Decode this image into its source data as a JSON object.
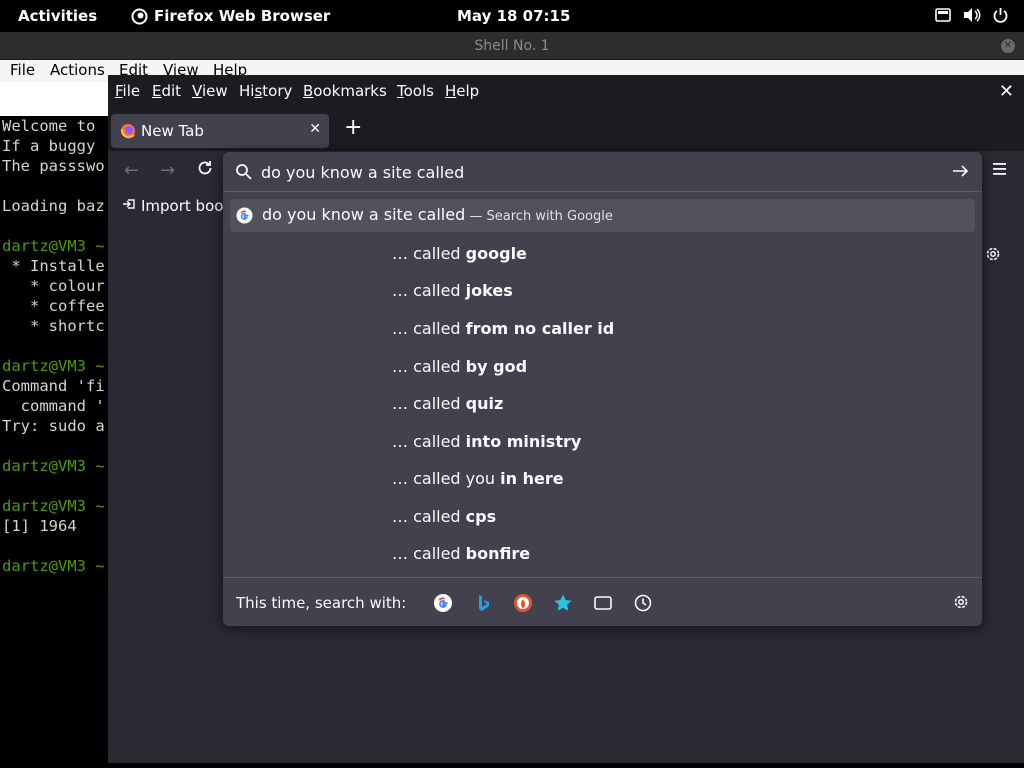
{
  "topbar": {
    "activities": "Activities",
    "app_name": "Firefox Web Browser",
    "clock": "May 18  07:15"
  },
  "terminal": {
    "title": "Shell No. 1",
    "menu": [
      "File",
      "Actions",
      "Edit",
      "View",
      "Help"
    ],
    "lines": [
      {
        "text": "Welcome to",
        "green": false
      },
      {
        "text": "If a buggy",
        "green": false
      },
      {
        "text": "The passswo",
        "green": false
      },
      {
        "text": "",
        "green": false
      },
      {
        "text": "Loading baz",
        "green": false
      },
      {
        "text": "",
        "green": false
      },
      {
        "text": "dartz@VM3 ~",
        "green": true
      },
      {
        "text": " * Installe",
        "green": false
      },
      {
        "text": "   * colour",
        "green": false
      },
      {
        "text": "   * coffee",
        "green": false
      },
      {
        "text": "   * shortc",
        "green": false
      },
      {
        "text": "",
        "green": false
      },
      {
        "text": "dartz@VM3 ~",
        "green": true
      },
      {
        "text": "Command 'fi",
        "green": false
      },
      {
        "text": "  command '",
        "green": false
      },
      {
        "text": "Try: sudo a",
        "green": false
      },
      {
        "text": "",
        "green": false
      },
      {
        "text": "dartz@VM3 ~",
        "green": true
      },
      {
        "text": "",
        "green": false
      },
      {
        "text": "dartz@VM3 ~",
        "green": true
      },
      {
        "text": "[1] 1964",
        "green": false
      },
      {
        "text": "",
        "green": false
      },
      {
        "text": "dartz@VM3 ~",
        "green": true
      }
    ]
  },
  "firefox": {
    "menu": {
      "file": {
        "u": "F",
        "rest": "ile"
      },
      "edit": {
        "u": "E",
        "rest": "dit"
      },
      "view": {
        "u": "V",
        "rest": "iew"
      },
      "history": {
        "pre": "Hi",
        "u": "s",
        "rest": "tory"
      },
      "bookmarks": {
        "u": "B",
        "rest": "ookmarks"
      },
      "tools": {
        "u": "T",
        "rest": "ools"
      },
      "help": {
        "u": "H",
        "rest": "elp"
      }
    },
    "tab_label": "New Tab",
    "import_bookmarks": "Import boo",
    "url_value": "do you know a site called",
    "heuristic": {
      "text": "do you know a site called",
      "action": " — Search with Google"
    },
    "suggestions": [
      {
        "prefix": "… called ",
        "plain": "",
        "bold": "google"
      },
      {
        "prefix": "… called ",
        "plain": "",
        "bold": "jokes"
      },
      {
        "prefix": "… called ",
        "plain": "",
        "bold": "from no caller id"
      },
      {
        "prefix": "… called ",
        "plain": "",
        "bold": "by god"
      },
      {
        "prefix": "… called ",
        "plain": "",
        "bold": "quiz"
      },
      {
        "prefix": "… called ",
        "plain": "",
        "bold": "into ministry"
      },
      {
        "prefix": "… called ",
        "plain": "you ",
        "bold": "in here"
      },
      {
        "prefix": "… called ",
        "plain": "",
        "bold": "cps"
      },
      {
        "prefix": "… called ",
        "plain": "",
        "bold": "bonfire"
      }
    ],
    "one_offs_label": "This time, search with:",
    "one_off_icons": [
      "google-icon",
      "bing-icon",
      "duckduckgo-icon",
      "bookmarks-star-icon",
      "tabs-icon",
      "history-icon"
    ]
  },
  "colors": {
    "terminal_prompt": "#4e9a06",
    "firefox_bg": "#2b2a33",
    "dropdown_bg": "#42414d",
    "selected_row": "#52525e"
  }
}
